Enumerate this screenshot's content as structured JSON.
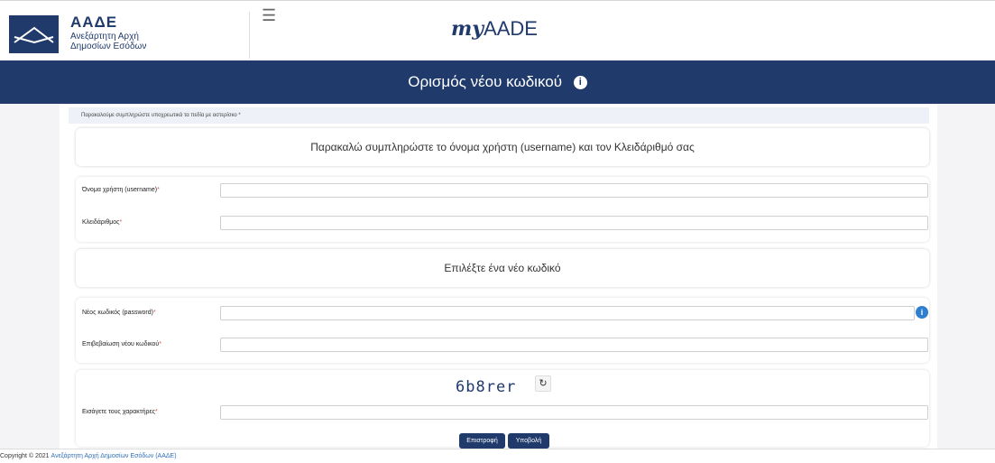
{
  "header": {
    "brand_name": "ΑΑΔΕ",
    "brand_line1": "Ανεξάρτητη Αρχή",
    "brand_line2": "Δημοσίων Εσόδων",
    "menu_icon": "hamburger-icon",
    "app_logo_prefix": "my",
    "app_logo_suffix": "AADE"
  },
  "banner": {
    "title": "Ορισμός νέου κωδικού",
    "info_icon": "i"
  },
  "form": {
    "hint": "Παρακαλούμε συμπληρώστε υποχρεωτικά τα πεδία με αστερίσκο *",
    "section1_title": "Παρακαλώ συμπληρώστε το όνομα χρήστη (username) και τον Κλειδάριθμό σας",
    "username_label": "Όνομα χρήστη (username)",
    "username_value": "",
    "kleidarithmos_label": "Κλειδάριθμος",
    "kleidarithmos_value": "",
    "section2_title": "Επιλέξτε ένα νέο κωδικό",
    "new_password_label": "Νέος κωδικός (password)",
    "new_password_value": "",
    "confirm_password_label": "Επιβεβαίωση νέου κωδικού",
    "confirm_password_value": "",
    "captcha_text": "6b8rer",
    "captcha_input_label": "Εισάγετε τους χαρακτήρες",
    "captcha_input_value": "",
    "required_mark": "*",
    "back_button": "Επιστροφή",
    "submit_button": "Υποβολή"
  },
  "footer": {
    "copyright": "Copyright © 2021 ",
    "link_text": "Ανεξάρτητη Αρχή Δημοσίων Εσόδων (ΑΑΔΕ)"
  },
  "colors": {
    "primary": "#1f3a6b",
    "required": "#d9534f",
    "info": "#2f7fd0"
  }
}
